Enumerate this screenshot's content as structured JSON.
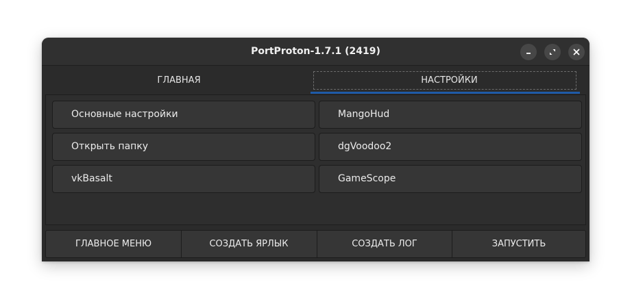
{
  "window": {
    "title": "PortProton-1.7.1 (2419)"
  },
  "title_controls": {
    "minimize": "minimize-icon",
    "maximize": "maximize-icon",
    "close": "close-icon"
  },
  "tabs": [
    {
      "label": "ГЛАВНАЯ",
      "active": false
    },
    {
      "label": "НАСТРОЙКИ",
      "active": true
    }
  ],
  "settings": {
    "left": [
      {
        "label": "Основные настройки"
      },
      {
        "label": "Открыть папку"
      },
      {
        "label": "vkBasalt"
      }
    ],
    "right": [
      {
        "label": "MangoHud"
      },
      {
        "label": "dgVoodoo2"
      },
      {
        "label": "GameScope"
      }
    ]
  },
  "bottom_bar": [
    {
      "label": "ГЛАВНОЕ МЕНЮ"
    },
    {
      "label": "СОЗДАТЬ ЯРЛЫК"
    },
    {
      "label": "СОЗДАТЬ ЛОГ"
    },
    {
      "label": "ЗАПУСТИТЬ"
    }
  ],
  "colors": {
    "accent": "#1e5aa8",
    "window_bg": "#2b2b2b",
    "button_bg": "#363636"
  }
}
